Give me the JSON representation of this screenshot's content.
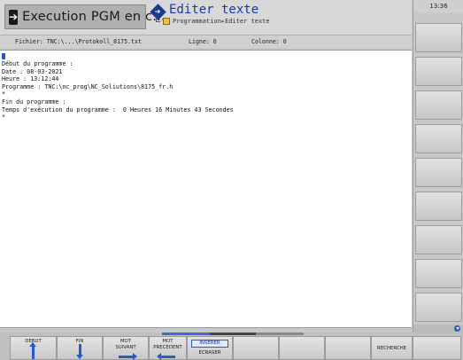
{
  "header": {
    "mode_title": "Execution PGM en c…",
    "editor_title": "Editer texte",
    "breadcrumb_a": "Programmation",
    "breadcrumb_b": "Editer texte"
  },
  "fileinfo": {
    "file": "Fichier: TNC:\\...\\Protokoll_8175.txt",
    "line": "Ligne:  0",
    "column": "Colonne: 0"
  },
  "editor": {
    "lines": [
      "Début du programme :",
      "Date : 08-03-2021",
      "Heure : 13:12:44",
      "Programme : TNC:\\nc_prog\\NC_Soliutions\\8175_fr.h",
      "*",
      "Fin du programme :",
      "Temps d'exécution du programme :  0 Heures 16 Minutes 43 Secondes",
      "*"
    ]
  },
  "clock": "13:36",
  "softkeys": {
    "debut": "DEBUT",
    "fin": "FIN",
    "mot_suivant_1": "MOT",
    "mot_suivant_2": "SUIVANT",
    "mot_precedent_1": "MOT",
    "mot_precedent_2": "PRECEDENT",
    "inserer": "INSERER",
    "ecraser": "ECRASER",
    "recherche": "RECHERCHE"
  },
  "colors": {
    "accent": "#2a5ac8",
    "title_blue": "#1a3aa8",
    "cursor": "#3050d8"
  },
  "icons": [
    "arrow-right-icon",
    "diamond-icon",
    "folder-icon",
    "arrow-up-icon",
    "arrow-down-icon",
    "arrow-right-icon",
    "arrow-left-icon",
    "scroll-down-icon"
  ]
}
